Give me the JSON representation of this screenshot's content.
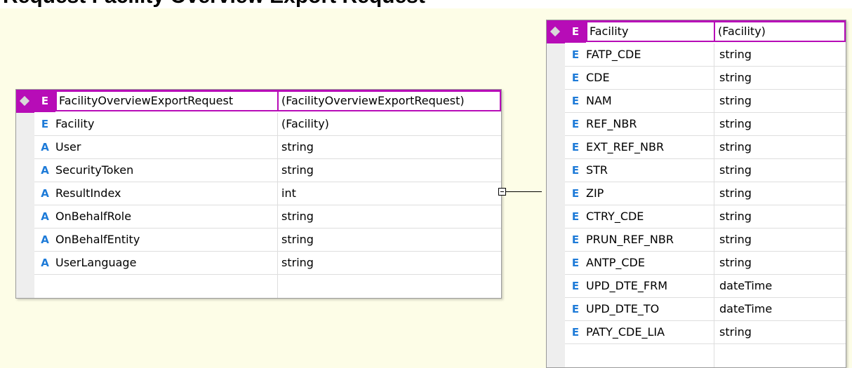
{
  "header": {
    "title_fragment": "Request Facility Overview Export Request"
  },
  "colors": {
    "canvas": "#fdfde7",
    "header_accent": "#b70cb7",
    "kind_marker": "#1e7bd8"
  },
  "left_entity": {
    "kind": "E",
    "name": "FacilityOverviewExportRequest",
    "type": "(FacilityOverviewExportRequest)",
    "rows": [
      {
        "kind": "E",
        "name": "Facility",
        "type": "(Facility)"
      },
      {
        "kind": "A",
        "name": "User",
        "type": "string"
      },
      {
        "kind": "A",
        "name": "SecurityToken",
        "type": "string"
      },
      {
        "kind": "A",
        "name": "ResultIndex",
        "type": "int"
      },
      {
        "kind": "A",
        "name": "OnBehalfRole",
        "type": "string"
      },
      {
        "kind": "A",
        "name": "OnBehalfEntity",
        "type": "string"
      },
      {
        "kind": "A",
        "name": "UserLanguage",
        "type": "string"
      }
    ]
  },
  "right_entity": {
    "kind": "E",
    "name": "Facility",
    "type": "(Facility)",
    "rows": [
      {
        "kind": "E",
        "name": "FATP_CDE",
        "type": "string"
      },
      {
        "kind": "E",
        "name": "CDE",
        "type": "string"
      },
      {
        "kind": "E",
        "name": "NAM",
        "type": "string"
      },
      {
        "kind": "E",
        "name": "REF_NBR",
        "type": "string"
      },
      {
        "kind": "E",
        "name": "EXT_REF_NBR",
        "type": "string"
      },
      {
        "kind": "E",
        "name": "STR",
        "type": "string"
      },
      {
        "kind": "E",
        "name": "ZIP",
        "type": "string"
      },
      {
        "kind": "E",
        "name": "CTRY_CDE",
        "type": "string"
      },
      {
        "kind": "E",
        "name": "PRUN_REF_NBR",
        "type": "string"
      },
      {
        "kind": "E",
        "name": "ANTP_CDE",
        "type": "string"
      },
      {
        "kind": "E",
        "name": "UPD_DTE_FRM",
        "type": "dateTime"
      },
      {
        "kind": "E",
        "name": "UPD_DTE_TO",
        "type": "dateTime"
      },
      {
        "kind": "E",
        "name": "PATY_CDE_LIA",
        "type": "string"
      }
    ]
  }
}
